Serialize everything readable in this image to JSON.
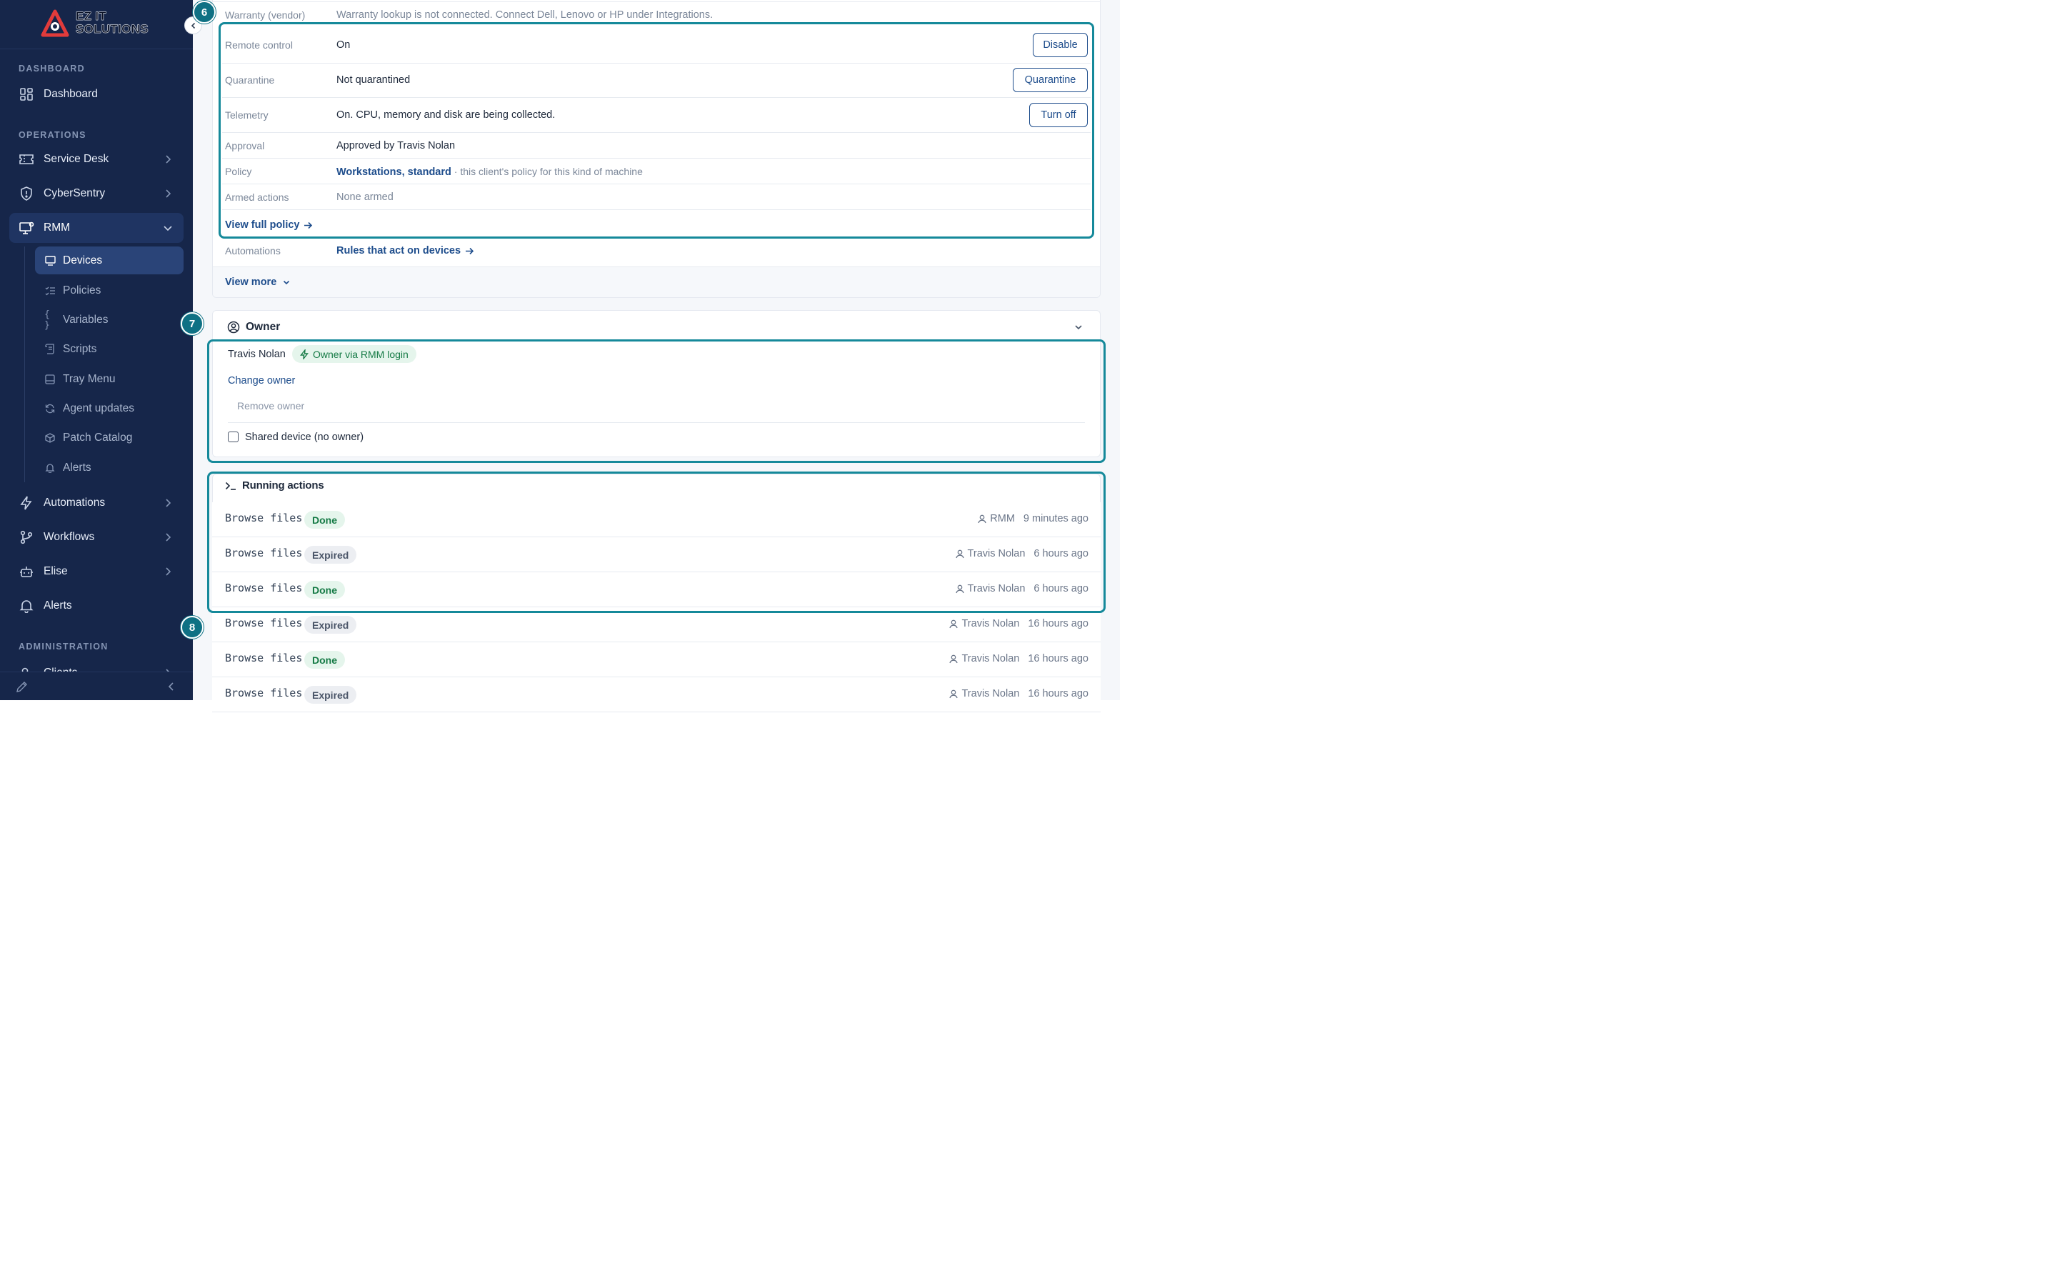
{
  "sidebar": {
    "logo_line1": "EZ IT",
    "logo_line2": "SOLUTIONS",
    "sections": {
      "dashboard": "DASHBOARD",
      "operations": "OPERATIONS",
      "administration": "ADMINISTRATION"
    },
    "items": {
      "dashboard": "Dashboard",
      "service_desk": "Service Desk",
      "cybersentry": "CyberSentry",
      "rmm": "RMM",
      "automations": "Automations",
      "workflows": "Workflows",
      "elise": "Elise",
      "alerts": "Alerts",
      "clients": "Clients"
    },
    "rmm_sub": {
      "devices": "Devices",
      "policies": "Policies",
      "variables": "Variables",
      "scripts": "Scripts",
      "tray_menu": "Tray Menu",
      "agent_updates": "Agent updates",
      "patch_catalog": "Patch Catalog",
      "alerts": "Alerts"
    }
  },
  "badges": {
    "b6": "6",
    "b7": "7",
    "b8": "8"
  },
  "details": {
    "warranty_label": "Warranty (vendor)",
    "warranty_value": "Warranty lookup is not connected. Connect Dell, Lenovo or HP under Integrations.",
    "remote_label": "Remote control",
    "remote_value": "On",
    "remote_btn": "Disable",
    "quarantine_label": "Quarantine",
    "quarantine_value": "Not quarantined",
    "quarantine_btn": "Quarantine",
    "telemetry_label": "Telemetry",
    "telemetry_value": "On. CPU, memory and disk are being collected.",
    "telemetry_btn": "Turn off",
    "approval_label": "Approval",
    "approval_value": "Approved by Travis Nolan",
    "policy_label": "Policy",
    "policy_link": "Workstations, standard",
    "policy_note": " · this client's policy for this kind of machine",
    "armed_label": "Armed actions",
    "armed_value": "None armed",
    "view_full_policy": "View full policy",
    "automations_label": "Automations",
    "automations_link": "Rules that act on devices",
    "view_more": "View more"
  },
  "owner": {
    "title": "Owner",
    "name": "Travis Nolan",
    "owner_badge": "Owner via RMM login",
    "change_owner": "Change owner",
    "remove_owner": "Remove owner",
    "shared_label": "Shared device (no owner)"
  },
  "running": {
    "title": "Running actions",
    "rows": [
      {
        "name": "Browse files",
        "status": "Done",
        "who": "RMM",
        "when": "9 minutes ago"
      },
      {
        "name": "Browse files",
        "status": "Expired",
        "who": "Travis Nolan",
        "when": "6 hours ago"
      },
      {
        "name": "Browse files",
        "status": "Done",
        "who": "Travis Nolan",
        "when": "6 hours ago"
      },
      {
        "name": "Browse files",
        "status": "Expired",
        "who": "Travis Nolan",
        "when": "16 hours ago"
      },
      {
        "name": "Browse files",
        "status": "Done",
        "who": "Travis Nolan",
        "when": "16 hours ago"
      },
      {
        "name": "Browse files",
        "status": "Expired",
        "who": "Travis Nolan",
        "when": "16 hours ago"
      }
    ]
  },
  "colors": {
    "accent": "#15899a",
    "brand": "#16264a",
    "link": "#1e4d8c",
    "done": "#157a45"
  }
}
